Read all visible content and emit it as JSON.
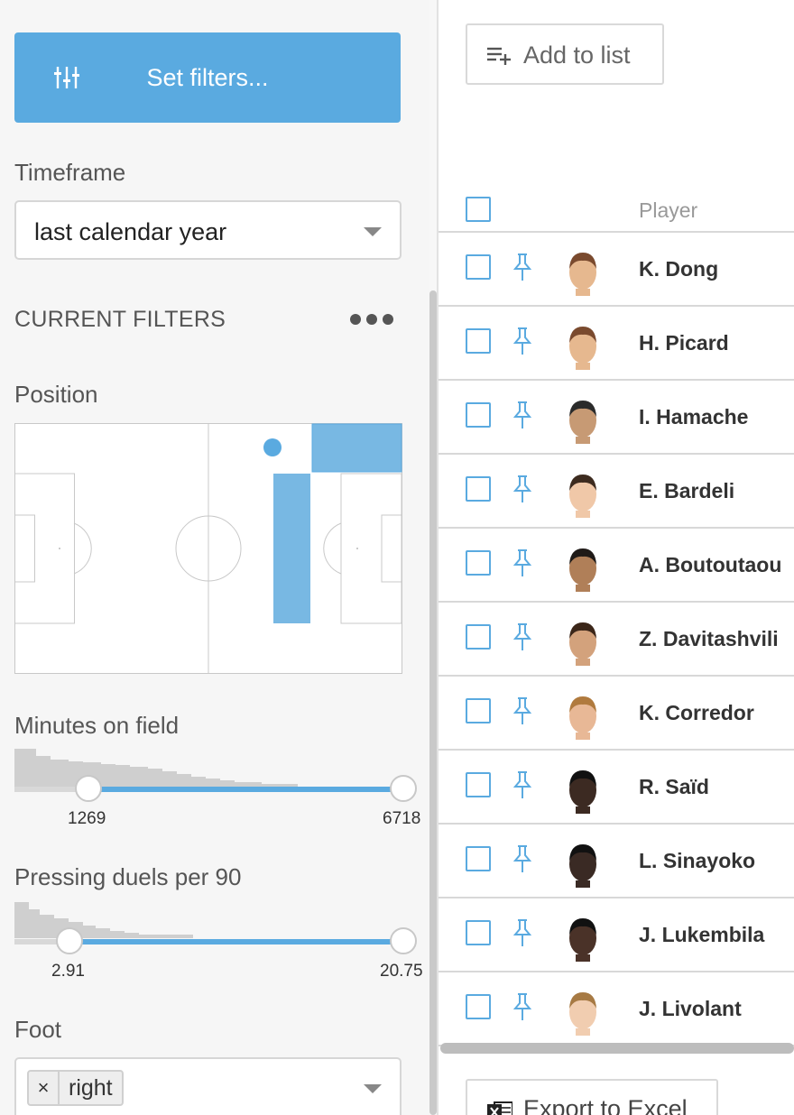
{
  "filters_panel": {
    "set_filters_label": "Set filters...",
    "timeframe_label": "Timeframe",
    "timeframe_value": "last calendar year",
    "current_filters_label": "CURRENT FILTERS",
    "position_label": "Position",
    "minutes_label": "Minutes on field",
    "minutes_min": "1269",
    "minutes_max": "6718",
    "pressing_label": "Pressing duels per 90",
    "pressing_min": "2.91",
    "pressing_max": "20.75",
    "foot_label": "Foot",
    "foot_chip_remove": "×",
    "foot_chip_value": "right"
  },
  "list_panel": {
    "add_to_list_label": "Add to list",
    "player_column_header": "Player",
    "export_label": "Export to Excel",
    "players": [
      {
        "name": "K. Dong",
        "avatar": "placeholder"
      },
      {
        "name": "H. Picard",
        "avatar": "placeholder"
      },
      {
        "name": "I. Hamache",
        "avatar": "photo"
      },
      {
        "name": "E. Bardeli",
        "avatar": "photo"
      },
      {
        "name": "A. Boutoutaou",
        "avatar": "photo"
      },
      {
        "name": "Z. Davitashvili",
        "avatar": "photo"
      },
      {
        "name": "K. Corredor",
        "avatar": "photo"
      },
      {
        "name": "R. Saïd",
        "avatar": "photo"
      },
      {
        "name": "L. Sinayoko",
        "avatar": "photo"
      },
      {
        "name": "J. Lukembila",
        "avatar": "photo"
      },
      {
        "name": "J. Livolant",
        "avatar": "photo"
      }
    ]
  },
  "colors": {
    "accent": "#5aaae0",
    "position_highlight": "#78b8e3"
  },
  "icons": [
    "sliders-icon",
    "caret-down-icon",
    "more-dots-icon",
    "add-to-list-icon",
    "checkbox-icon",
    "pin-icon",
    "excel-icon"
  ]
}
